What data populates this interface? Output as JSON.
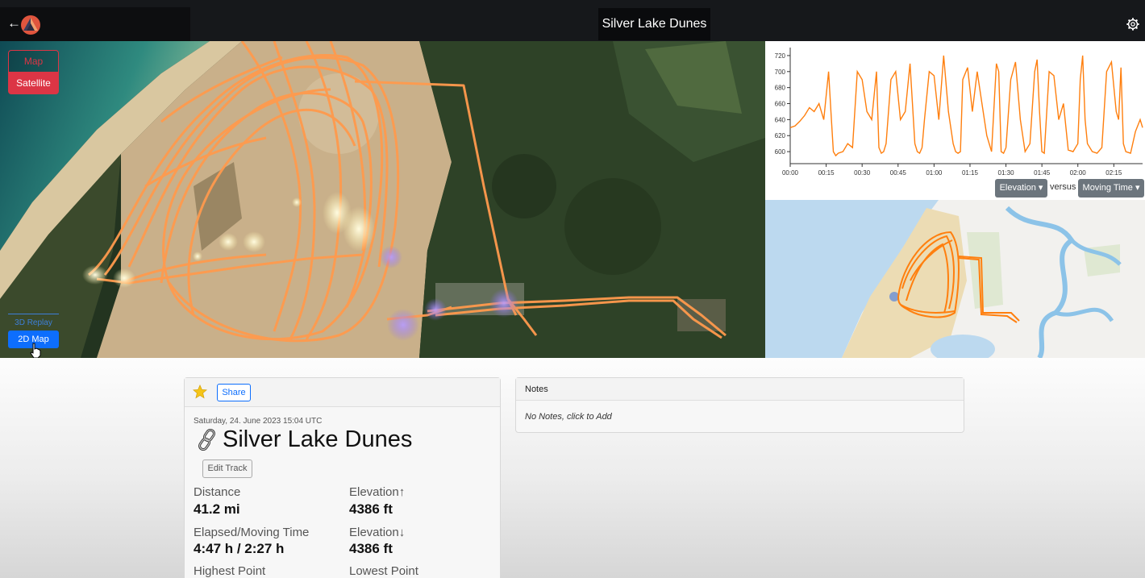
{
  "header": {
    "title": "Silver Lake Dunes",
    "back_icon": "←"
  },
  "map_controls": {
    "map_label": "Map",
    "satellite_label": "Satellite",
    "view_3d_label": "3D Replay",
    "view_2d_label": "2D Map"
  },
  "chart_data": {
    "type": "line",
    "title": "",
    "xlabel": "",
    "ylabel": "",
    "x_ticks": [
      "00:00",
      "00:15",
      "00:30",
      "00:45",
      "01:00",
      "01:15",
      "01:30",
      "01:45",
      "02:00",
      "02:15"
    ],
    "y_ticks": [
      600,
      620,
      640,
      660,
      680,
      700,
      720
    ],
    "ylim": [
      585,
      730
    ],
    "xlim_minutes": [
      0,
      147
    ],
    "grid": false,
    "color": "#ff7f0e",
    "series": [
      {
        "values_x_minutes": [
          0,
          2,
          4,
          6,
          8,
          10,
          12,
          14,
          16,
          17,
          18,
          19,
          20,
          22,
          24,
          26,
          28,
          30,
          32,
          34,
          36,
          37,
          38,
          39,
          40,
          42,
          44,
          46,
          48,
          50,
          52,
          53,
          54,
          55,
          56,
          58,
          60,
          62,
          64,
          66,
          68,
          69,
          70,
          71,
          72,
          74,
          76,
          78,
          80,
          82,
          84,
          86,
          87,
          88,
          89,
          90,
          92,
          94,
          96,
          98,
          100,
          102,
          103,
          104,
          105,
          106,
          108,
          110,
          112,
          114,
          116,
          118,
          120,
          121,
          122,
          123,
          124,
          126,
          128,
          130,
          132,
          134,
          136,
          137,
          138,
          139,
          140,
          142,
          144,
          146,
          147
        ],
        "values_y": [
          630,
          632,
          638,
          645,
          655,
          650,
          660,
          640,
          700,
          650,
          600,
          595,
          598,
          600,
          610,
          605,
          700,
          690,
          650,
          640,
          700,
          605,
          598,
          600,
          610,
          690,
          700,
          640,
          650,
          710,
          610,
          600,
          598,
          605,
          640,
          700,
          695,
          640,
          720,
          650,
          610,
          600,
          598,
          600,
          690,
          705,
          650,
          700,
          660,
          620,
          600,
          710,
          700,
          600,
          598,
          605,
          690,
          712,
          640,
          600,
          610,
          700,
          715,
          650,
          600,
          598,
          700,
          695,
          640,
          660,
          602,
          600,
          610,
          690,
          720,
          640,
          610,
          600,
          598,
          605,
          700,
          712,
          650,
          640,
          705,
          610,
          600,
          598,
          625,
          640,
          630
        ]
      }
    ]
  },
  "chart_controls": {
    "y_select": "Elevation",
    "versus_label": "versus",
    "x_select": "Moving Time"
  },
  "track": {
    "share_label": "Share",
    "date": "Saturday, 24. June 2023 15:04 UTC",
    "name": "Silver Lake Dunes",
    "edit_label": "Edit Track",
    "stats": {
      "distance_label": "Distance",
      "distance_value": "41.2 mi",
      "elev_up_label": "Elevation↑",
      "elev_up_value": "4386 ft",
      "time_label": "Elapsed/Moving Time",
      "time_value": "4:47 h / 2:27 h",
      "elev_down_label": "Elevation↓",
      "elev_down_value": "4386 ft",
      "highest_label": "Highest Point",
      "lowest_label": "Lowest Point"
    }
  },
  "notes": {
    "header": "Notes",
    "empty_text": "No Notes, click to Add"
  },
  "colors": {
    "track": "#ff9a4d",
    "accent_red": "#dc3545",
    "accent_blue": "#0d6efd",
    "chart_line": "#ff7f0e"
  },
  "icons": {
    "back": "arrow-left-icon",
    "logo": "app-logo-icon",
    "settings": "gear-icon",
    "favorite": "star-icon",
    "track_type": "link-chain-icon",
    "cursor": "hand-cursor-icon"
  }
}
